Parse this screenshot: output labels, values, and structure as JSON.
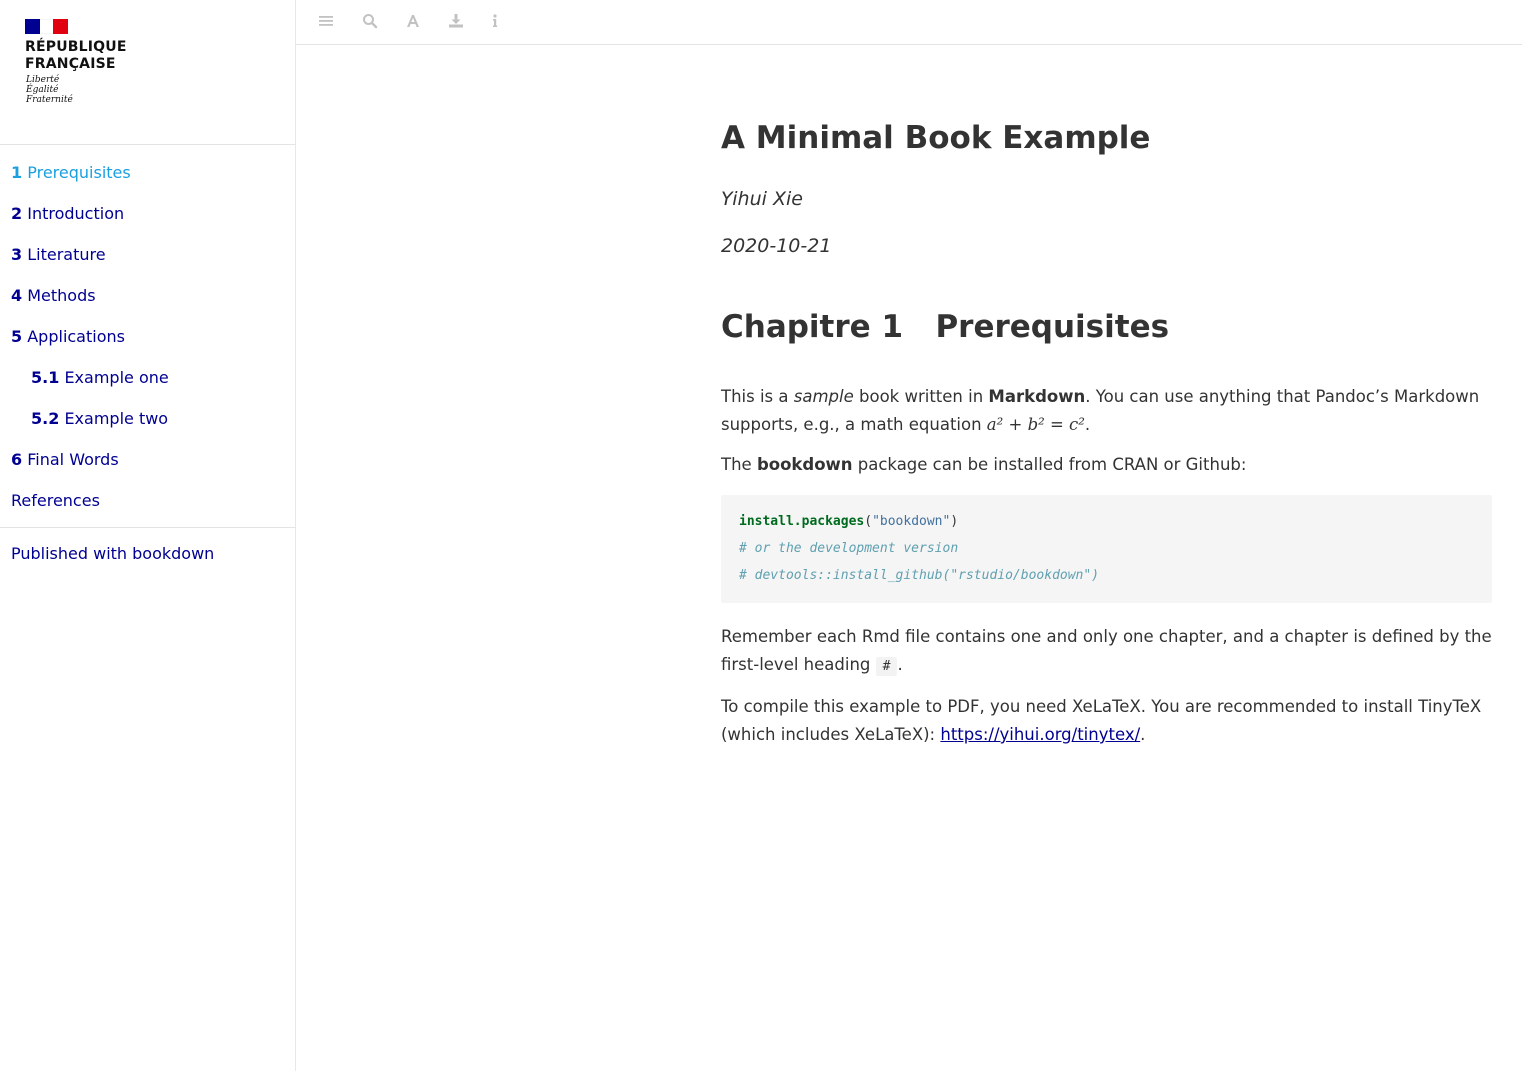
{
  "logo": {
    "name": "RÉPUBLIQUE\nFRANÇAISE",
    "motto": "Liberté\nÉgalité\nFraternité",
    "flag_colors": [
      "#000091",
      "#ffffff",
      "#e1000f"
    ]
  },
  "toolbar": {
    "icons": [
      "menu-icon",
      "search-icon",
      "font-icon",
      "download-icon",
      "info-icon"
    ]
  },
  "toc": [
    {
      "num": "1",
      "label": "Prerequisites",
      "active": true
    },
    {
      "num": "2",
      "label": "Introduction"
    },
    {
      "num": "3",
      "label": "Literature"
    },
    {
      "num": "4",
      "label": "Methods"
    },
    {
      "num": "5",
      "label": "Applications"
    },
    {
      "num": "5.1",
      "label": "Example one"
    },
    {
      "num": "5.2",
      "label": "Example two"
    },
    {
      "num": "6",
      "label": "Final Words"
    },
    {
      "num": "",
      "label": "References"
    }
  ],
  "published_label": "Published with bookdown",
  "book": {
    "title": "A Minimal Book Example",
    "author": "Yihui Xie",
    "date": "2020-10-21"
  },
  "chapter": {
    "prefix": "Chapitre 1",
    "title": "Prerequisites",
    "p1": {
      "t1": "This is a ",
      "em": "sample",
      "t2": " book written in ",
      "strong": "Markdown",
      "t3": ". You can use anything that Pandoc’s Markdown supports, e.g., a math equation ",
      "math": "a² + b² = c²",
      "t4": "."
    },
    "p2": {
      "t1": "The ",
      "strong": "bookdown",
      "t2": " package can be installed from CRAN or Github:"
    },
    "code": {
      "fn": "install.packages",
      "open": "(",
      "arg": "\"bookdown\"",
      "close": ")",
      "comment1": "# or the development version",
      "comment2": "# devtools::install_github(\"rstudio/bookdown\")"
    },
    "p3": {
      "t1": "Remember each Rmd file contains one and only one chapter, and a chapter is defined by the first-level heading ",
      "code": "#",
      "t2": "."
    },
    "p4": {
      "t1": "To compile this example to PDF, you need XeLaTeX. You are recommended to install TinyTeX (which includes XeLaTeX): ",
      "link": "https://yihui.org/tinytex/",
      "t2": "."
    }
  }
}
